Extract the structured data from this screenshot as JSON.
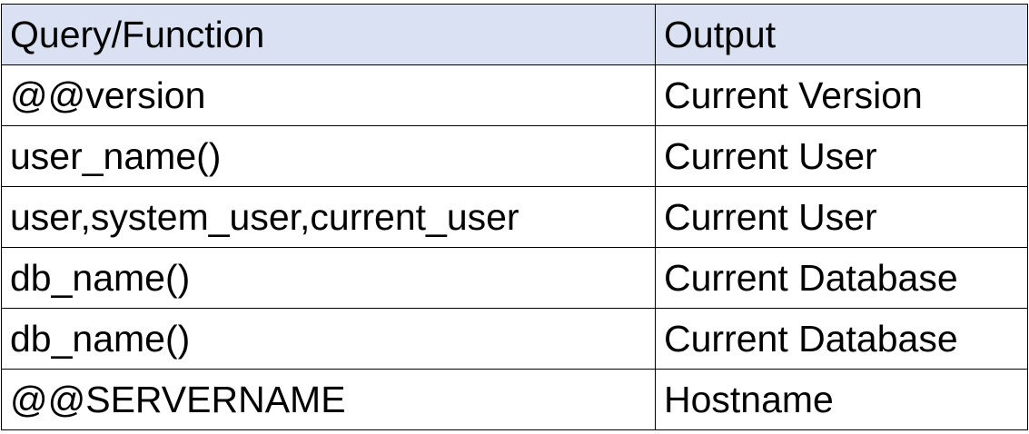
{
  "table": {
    "header_bg": "#d9e1f2",
    "columns": [
      "Query/Function",
      "Output"
    ],
    "rows": [
      [
        "@@version",
        "Current Version"
      ],
      [
        "user_name()",
        "Current User"
      ],
      [
        "user,system_user,current_user",
        "Current User"
      ],
      [
        "db_name()",
        "Current Database"
      ],
      [
        "db_name()",
        "Current Database"
      ],
      [
        "@@SERVERNAME",
        "Hostname"
      ]
    ]
  }
}
